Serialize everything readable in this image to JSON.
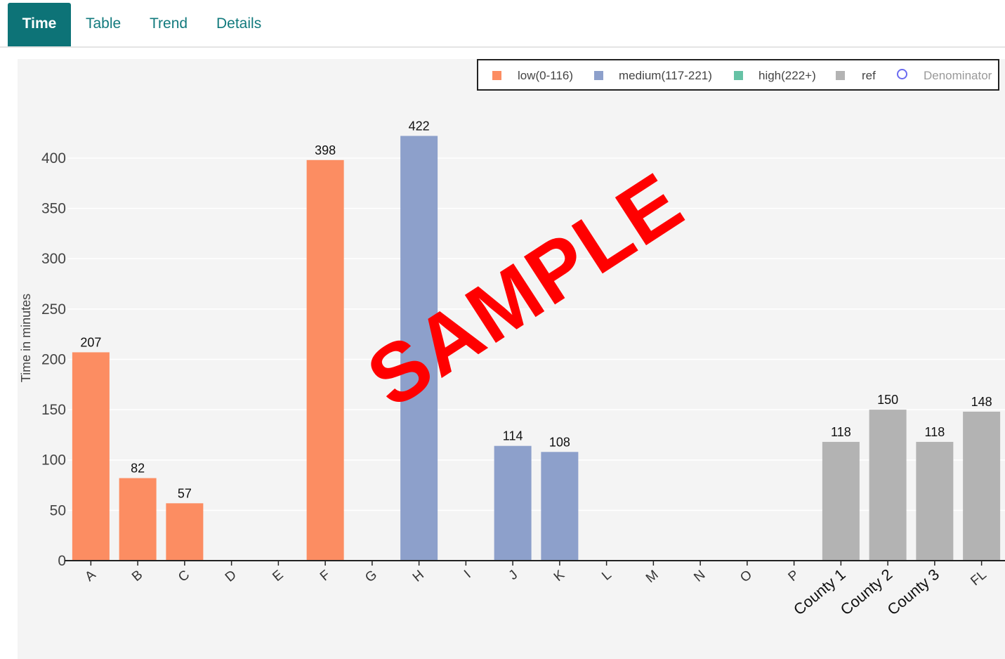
{
  "tabs": [
    {
      "label": "Time",
      "active": true
    },
    {
      "label": "Table",
      "active": false
    },
    {
      "label": "Trend",
      "active": false
    },
    {
      "label": "Details",
      "active": false
    }
  ],
  "legend": [
    {
      "label": "low(0-116)",
      "color": "#fc8d62",
      "shape": "square"
    },
    {
      "label": "medium(117-221)",
      "color": "#8da0cb",
      "shape": "square"
    },
    {
      "label": "high(222+)",
      "color": "#66c2a5",
      "shape": "square"
    },
    {
      "label": "ref",
      "color": "#b3b3b3",
      "shape": "square"
    },
    {
      "label": "Denominator",
      "color": "#6a6af0",
      "shape": "circle"
    }
  ],
  "watermark": "SAMPLE",
  "chart_data": {
    "type": "bar",
    "ylabel": "Time in minutes",
    "xlabel": "",
    "ylim": [
      0,
      420
    ],
    "yticks": [
      0,
      50,
      100,
      150,
      200,
      250,
      300,
      350,
      400
    ],
    "grid": true,
    "legend_position": "top-right",
    "categories": [
      "A",
      "B",
      "C",
      "D",
      "E",
      "F",
      "G",
      "H",
      "I",
      "J",
      "K",
      "L",
      "M",
      "N",
      "O",
      "P",
      "County 1",
      "County 2",
      "County 3",
      "FL"
    ],
    "values": [
      207,
      82,
      57,
      null,
      null,
      398,
      null,
      422,
      null,
      114,
      108,
      null,
      null,
      null,
      null,
      null,
      118,
      150,
      118,
      148
    ],
    "colors": [
      "#fc8d62",
      "#fc8d62",
      "#fc8d62",
      "#fc8d62",
      "#fc8d62",
      "#fc8d62",
      "#fc8d62",
      "#8da0cb",
      "#8da0cb",
      "#8da0cb",
      "#8da0cb",
      "#8da0cb",
      "#8da0cb",
      "#8da0cb",
      "#8da0cb",
      "#8da0cb",
      "#b3b3b3",
      "#b3b3b3",
      "#b3b3b3",
      "#b3b3b3"
    ]
  }
}
